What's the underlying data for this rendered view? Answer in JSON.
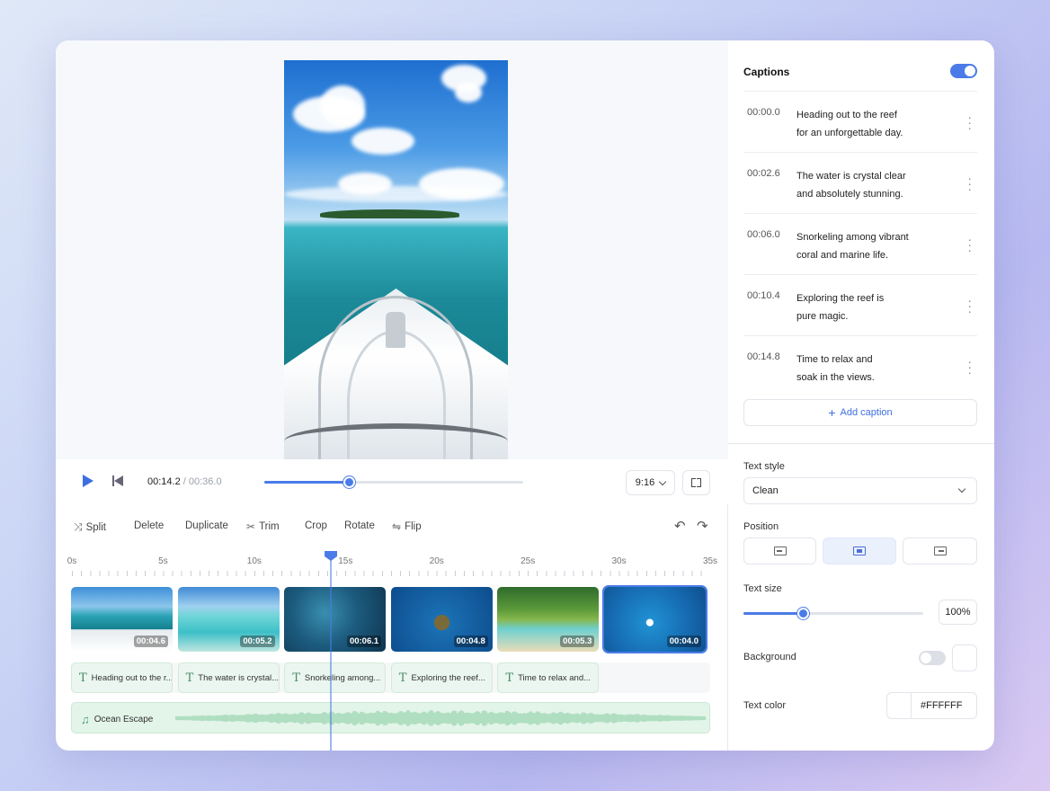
{
  "player": {
    "current_time": "00:14.2",
    "separator": " / ",
    "total_time": "00:36.0",
    "progress": 0.325,
    "aspect_ratio": "9:16"
  },
  "toolbar": {
    "split": "Split",
    "delete": "Delete",
    "duplicate": "Duplicate",
    "trim": "Trim",
    "crop": "Crop",
    "rotate": "Rotate",
    "flip": "Flip"
  },
  "ruler": {
    "labels": [
      "0s",
      "5s",
      "10s",
      "15s",
      "20s",
      "25s",
      "30s",
      "35s"
    ],
    "playhead_seconds": 14.2
  },
  "video_clips": [
    {
      "duration": "00:04.6",
      "scene": "boat-bow"
    },
    {
      "duration": "00:05.2",
      "scene": "shallow-beach"
    },
    {
      "duration": "00:06.1",
      "scene": "coral-reef"
    },
    {
      "duration": "00:04.8",
      "scene": "sea-turtle"
    },
    {
      "duration": "00:05.3",
      "scene": "palm-beach"
    },
    {
      "duration": "00:04.0",
      "scene": "speedboat",
      "selected": true
    }
  ],
  "caption_clips": [
    "Heading out to the r...",
    "The water is crystal...",
    "Snorkeling among...",
    "Exploring the reef...",
    "Time to relax and..."
  ],
  "audio": {
    "icon": "music-note-icon",
    "title": "Ocean Escape"
  },
  "captions_panel": {
    "title": "Captions",
    "enabled": true,
    "items": [
      {
        "time": "00:00.0",
        "line1": "Heading out to the reef",
        "line2": "for an unforgettable day."
      },
      {
        "time": "00:02.6",
        "line1": "The water is crystal clear",
        "line2": "and absolutely stunning."
      },
      {
        "time": "00:06.0",
        "line1": "Snorkeling among vibrant",
        "line2": "coral and marine life."
      },
      {
        "time": "00:10.4",
        "line1": "Exploring the reef is",
        "line2": "pure magic."
      },
      {
        "time": "00:14.8",
        "line1": "Time to relax and",
        "line2": "soak in the views."
      }
    ],
    "add_label": "Add caption"
  },
  "style_panel": {
    "text_style_label": "Text style",
    "text_style_value": "Clean",
    "position_label": "Position",
    "position_selected": "center",
    "text_size_label": "Text size",
    "text_size_value": "100%",
    "text_size_fraction": 0.33,
    "background_label": "Background",
    "background_enabled": false,
    "text_color_label": "Text color",
    "text_color_value": "#FFFFFF"
  },
  "colors": {
    "accent": "#4a7be8",
    "caption_track": "#eaf6ef",
    "audio_track": "#e3f4e9"
  }
}
